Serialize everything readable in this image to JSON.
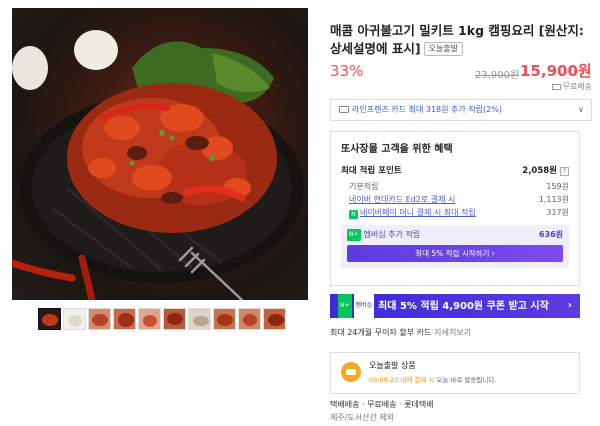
{
  "product": {
    "title": "매콤 아귀불고기 밀키트 1kg 캠핑요리 [원산지:상세설명에 표시]",
    "chip": "오늘출발",
    "discount": "33%",
    "original_price": "23,900원",
    "price": "15,900원",
    "shipping": "무료배송"
  },
  "card_bar": {
    "text": "라인프렌즈 카드 최대 318원 추가 적립(2%)",
    "chevron": "∨"
  },
  "benefit": {
    "title": "또사장몰 고객을 위한 혜택",
    "max_label": "최대 적립 포인트",
    "max_value": "2,058원",
    "qmark": "?",
    "rows": [
      {
        "label": "기본적립",
        "value": "159원"
      },
      {
        "label": "네이버 현대카드 Ed2로 결제 시",
        "value": "1,113원"
      },
      {
        "label": "네이버페이 머니 결제 시 최대 적립",
        "value": "317원"
      }
    ],
    "npay_badge": "N",
    "membership_badge": "N+",
    "membership_label": "멤버십 추가 적립",
    "membership_value": "636원",
    "membership_button": "최대 5% 적립 시작하기 ›"
  },
  "coupon": {
    "tag1": "N+",
    "tag2": "멤버십",
    "text": "최대 5% 적립  4,900원 쿠폰 받고 시작",
    "chevron": "›"
  },
  "installment": {
    "text": "최대 24개월 무이자 할부 카드",
    "more": "자세히보기"
  },
  "delivery": {
    "title": "오늘출발 상품",
    "time": "03:08:23 내에 결제 시",
    "rest": "오늘 바로 발송됩니다."
  },
  "shipping_info": {
    "line1": "택배배송  ·  무료배송  ·  롯데택배",
    "line2": "제주/도서산간 제외"
  },
  "colors": {
    "price_red": "#f04e57",
    "naver_green": "#03c75a",
    "membership_purple": "#5b3ce0"
  },
  "gallery": {
    "thumbnail_count": 10,
    "active_thumbnail": 1
  }
}
